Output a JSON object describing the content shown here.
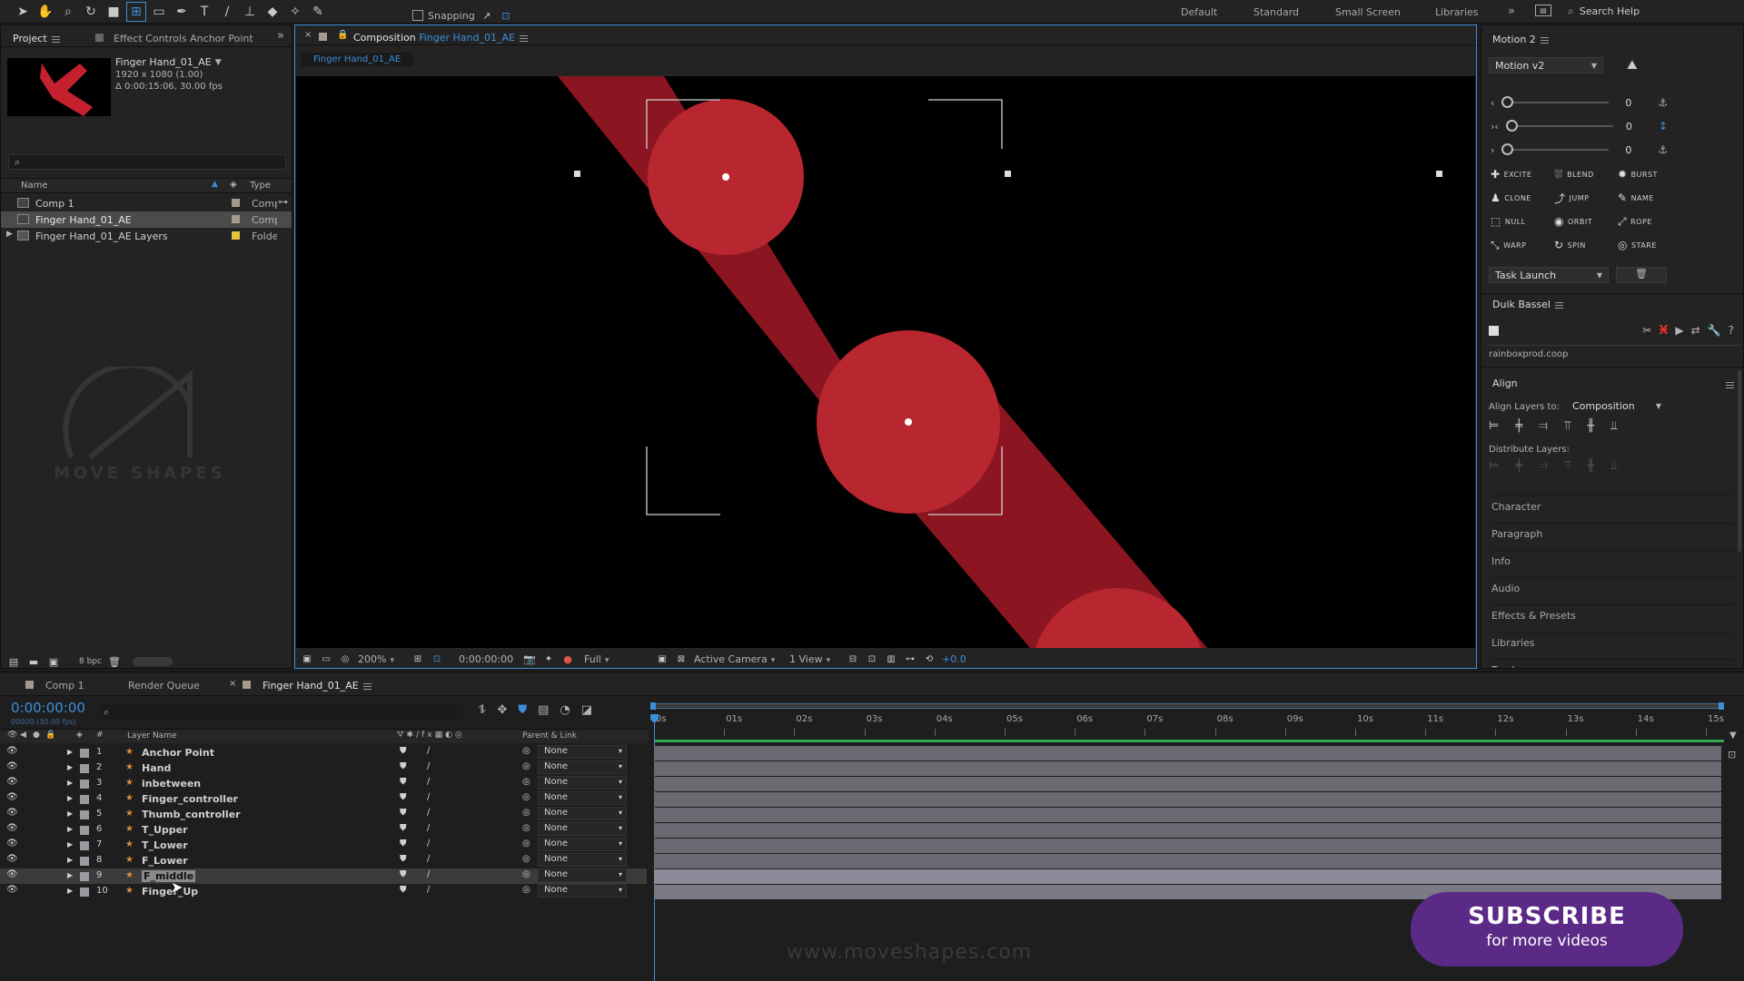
{
  "toolbar": {
    "snapping_label": "Snapping",
    "workspaces": [
      "Default",
      "Standard",
      "Small Screen",
      "Libraries"
    ],
    "search_placeholder": "Search Help"
  },
  "project_panel": {
    "tab_project": "Project",
    "tab_effect_controls": "Effect Controls Anchor Point",
    "selected_name": "Finger Hand_01_AE",
    "selected_size": "1920 x 1080 (1.00)",
    "selected_duration": "Δ 0:00:15:06, 30.00 fps",
    "col_name": "Name",
    "col_type": "Type",
    "items": [
      {
        "name": "Comp 1",
        "type": "Comp"
      },
      {
        "name": "Finger Hand_01_AE",
        "type": "Comp"
      },
      {
        "name": "Finger Hand_01_AE Layers",
        "type": "Folde"
      }
    ],
    "watermark": "MOVE SHAPES",
    "bpc": "8 bpc"
  },
  "composition": {
    "tab_prefix": "Composition",
    "tab_name": "Finger Hand_01_AE",
    "subtab": "Finger Hand_01_AE",
    "zoom": "200%",
    "timecode": "0:00:00:00",
    "resolution": "Full",
    "camera": "Active Camera",
    "view": "1 View",
    "exposure": "+0.0",
    "colors": {
      "arm": "#8b1520",
      "joint": "#b8262f",
      "bg": "#000000"
    }
  },
  "motion2": {
    "title": "Motion 2",
    "version": "Motion v2",
    "slider_values": [
      "0",
      "0",
      "0"
    ],
    "buttons": [
      "EXCITE",
      "BLEND",
      "BURST",
      "CLONE",
      "JUMP",
      "NAME",
      "NULL",
      "ORBIT",
      "ROPE",
      "WARP",
      "SPIN",
      "STARE"
    ],
    "task": "Task Launch"
  },
  "duik": {
    "title": "Duik Bassel",
    "footer": "rainboxprod.coop"
  },
  "align": {
    "title": "Align",
    "align_to_label": "Align Layers to:",
    "align_to_value": "Composition",
    "distribute_label": "Distribute Layers:"
  },
  "side_panels": [
    "Character",
    "Paragraph",
    "Info",
    "Audio",
    "Effects & Presets",
    "Libraries",
    "Tracker"
  ],
  "timeline": {
    "tabs": [
      "Comp 1",
      "Render Queue",
      "Finger Hand_01_AE"
    ],
    "timecode": "0:00:00:00",
    "fps_note": "00000 (30.00 fps)",
    "col_layer_name": "Layer Name",
    "col_parent": "Parent & Link",
    "ruler": [
      "0s",
      "01s",
      "02s",
      "03s",
      "04s",
      "05s",
      "06s",
      "07s",
      "08s",
      "09s",
      "10s",
      "11s",
      "12s",
      "13s",
      "14s",
      "15s"
    ],
    "layers": [
      {
        "num": "1",
        "name": "Anchor Point",
        "parent": "None"
      },
      {
        "num": "2",
        "name": "Hand",
        "parent": "None"
      },
      {
        "num": "3",
        "name": "inbetween",
        "parent": "None"
      },
      {
        "num": "4",
        "name": "Finger_controller",
        "parent": "None"
      },
      {
        "num": "5",
        "name": "Thumb_controller",
        "parent": "None"
      },
      {
        "num": "6",
        "name": "T_Upper",
        "parent": "None"
      },
      {
        "num": "7",
        "name": "T_Lower",
        "parent": "None"
      },
      {
        "num": "8",
        "name": "F_Lower",
        "parent": "None"
      },
      {
        "num": "9",
        "name": "F_middle",
        "parent": "None"
      },
      {
        "num": "10",
        "name": "Finger_Up",
        "parent": "None"
      }
    ]
  },
  "overlay": {
    "website": "www.moveshapes.com",
    "subscribe_title": "SUBSCRIBE",
    "subscribe_sub": "for more videos",
    "subscribe_color": "#5b2a86"
  }
}
